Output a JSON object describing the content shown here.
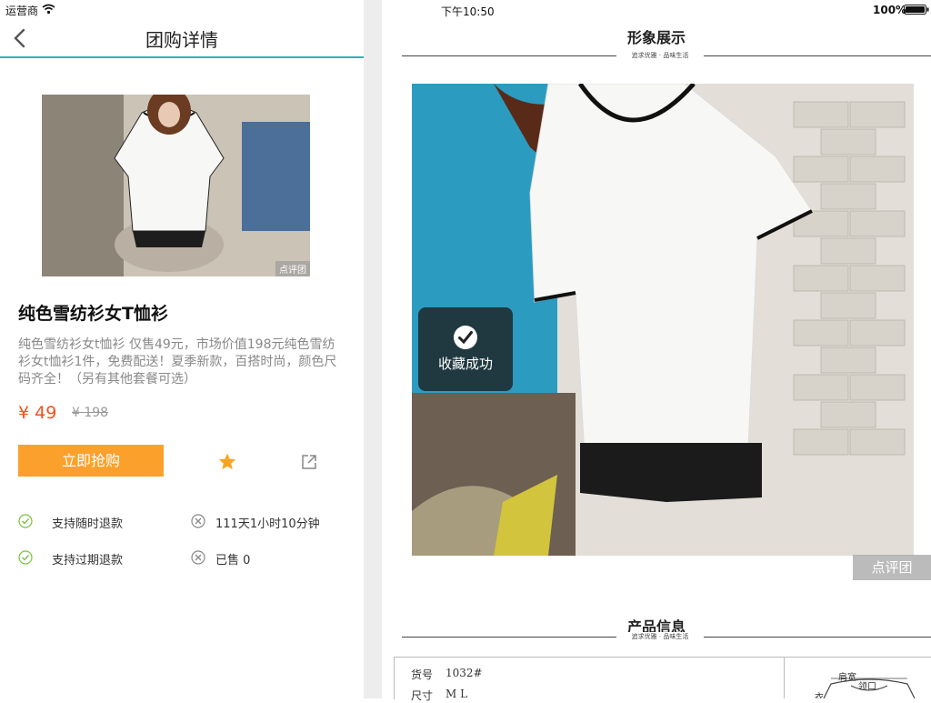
{
  "status_left": {
    "carrier": "运营商",
    "wifi_icon": "wifi-icon"
  },
  "status_right": {
    "time": "下午10:50",
    "battery": "100%",
    "battery_icon": "battery-icon"
  },
  "nav": {
    "title": "团购详情",
    "back_icon": "chevron-left-icon"
  },
  "product": {
    "image_watermark": "点评团",
    "title": "纯色雪纺衫女T恤衫",
    "description": "纯色雪纺衫女t恤衫 仅售49元，市场价值198元纯色雪纺衫女t恤衫1件，免费配送！夏季新款，百搭时尚，颜色尺码齐全！（另有其他套餐可选）",
    "price": "¥ 49",
    "original_price": "¥ 198",
    "buy_label": "立即抢购",
    "favorite_icon": "star-icon",
    "share_icon": "share-icon"
  },
  "features": [
    {
      "text": "支持随时退款",
      "icon": "check-circle-icon"
    },
    {
      "text": "111天1小时10分钟",
      "icon": "x-circle-icon"
    },
    {
      "text": "支持过期退款",
      "icon": "check-circle-icon"
    },
    {
      "text": "已售 0",
      "icon": "x-circle-icon"
    }
  ],
  "right": {
    "section1_title": "形象展示",
    "section1_sub": "追求优雅 · 品味生活",
    "image_watermark": "点评团",
    "toast_text": "收藏成功",
    "section2_title": "产品信息",
    "section2_sub": "追求优雅 · 品味生活",
    "table": {
      "row1_label": "货号",
      "row1_value": "1032#",
      "row2_label": "尺寸",
      "row2_value": "M L",
      "diagram_label1": "肩宽",
      "diagram_label2": "领口",
      "diagram_label3": "衣"
    }
  },
  "colors": {
    "accent": "#2bb4ae",
    "buy_button": "#fba12b",
    "price": "#f5501e",
    "star": "#f7a521",
    "check": "#7bc142"
  }
}
